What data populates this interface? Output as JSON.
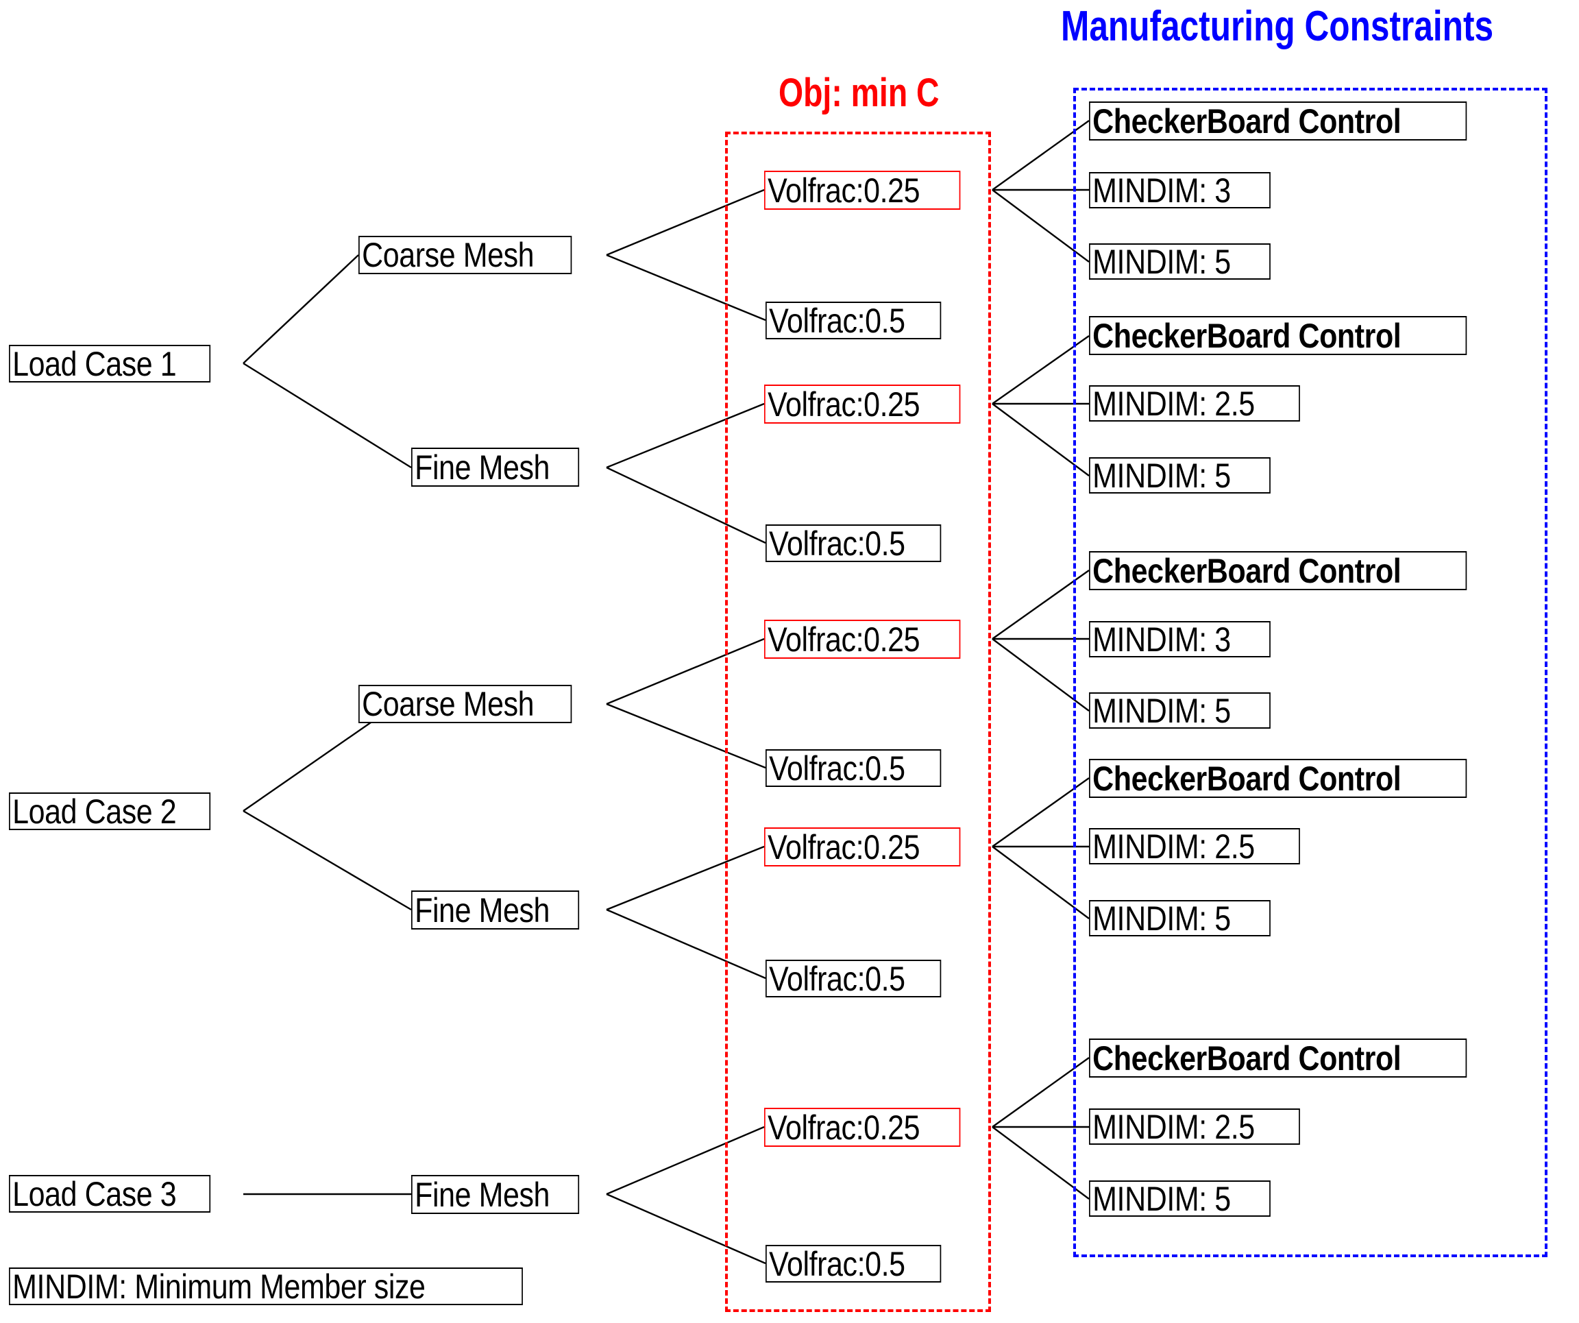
{
  "diagram": {
    "title_objective": "Obj: min C",
    "title_manufacturing": "Manufacturing Constraints",
    "legend": "MINDIM: Minimum Member size",
    "colors": {
      "objective_region": "#ff0000",
      "manufacturing_region": "#0000ff",
      "node_border": "#000000",
      "highlighted_node_border": "#ff0000"
    },
    "load_cases": [
      {
        "label": "Load Case 1",
        "meshes": [
          {
            "label": "Coarse Mesh",
            "volfracs": [
              {
                "label": "Volfrac:0.25",
                "highlighted": true,
                "constraints": [
                  "CheckerBoard Control",
                  "MINDIM: 3",
                  "MINDIM: 5"
                ]
              },
              {
                "label": "Volfrac:0.5",
                "highlighted": false,
                "constraints": []
              }
            ]
          },
          {
            "label": "Fine Mesh",
            "volfracs": [
              {
                "label": "Volfrac:0.25",
                "highlighted": true,
                "constraints": [
                  "CheckerBoard Control",
                  "MINDIM: 2.5",
                  "MINDIM: 5"
                ]
              },
              {
                "label": "Volfrac:0.5",
                "highlighted": false,
                "constraints": []
              }
            ]
          }
        ]
      },
      {
        "label": "Load Case 2",
        "meshes": [
          {
            "label": "Coarse Mesh",
            "volfracs": [
              {
                "label": "Volfrac:0.25",
                "highlighted": true,
                "constraints": [
                  "CheckerBoard Control",
                  "MINDIM: 3",
                  "MINDIM: 5"
                ]
              },
              {
                "label": "Volfrac:0.5",
                "highlighted": false,
                "constraints": []
              }
            ]
          },
          {
            "label": "Fine Mesh",
            "volfracs": [
              {
                "label": "Volfrac:0.25",
                "highlighted": true,
                "constraints": [
                  "CheckerBoard Control",
                  "MINDIM: 2.5",
                  "MINDIM: 5"
                ]
              },
              {
                "label": "Volfrac:0.5",
                "highlighted": false,
                "constraints": []
              }
            ]
          }
        ]
      },
      {
        "label": "Load Case 3",
        "meshes": [
          {
            "label": "Fine Mesh",
            "volfracs": [
              {
                "label": "Volfrac:0.25",
                "highlighted": true,
                "constraints": [
                  "CheckerBoard Control",
                  "MINDIM: 2.5",
                  "MINDIM: 5"
                ]
              },
              {
                "label": "Volfrac:0.5",
                "highlighted": false,
                "constraints": []
              }
            ]
          }
        ]
      }
    ],
    "nodes": {
      "load_case_1": "Load Case 1",
      "load_case_2": "Load Case 2",
      "load_case_3": "Load Case 3",
      "coarse_mesh_1": "Coarse Mesh",
      "fine_mesh_1": "Fine Mesh",
      "coarse_mesh_2": "Coarse Mesh",
      "fine_mesh_2": "Fine Mesh",
      "fine_mesh_3": "Fine Mesh",
      "vf_a_25": "Volfrac:0.25",
      "vf_a_50": "Volfrac:0.5",
      "vf_b_25": "Volfrac:0.25",
      "vf_b_50": "Volfrac:0.5",
      "vf_c_25": "Volfrac:0.25",
      "vf_c_50": "Volfrac:0.5",
      "vf_d_25": "Volfrac:0.25",
      "vf_d_50": "Volfrac:0.5",
      "vf_e_25": "Volfrac:0.25",
      "vf_e_50": "Volfrac:0.5",
      "cb_1": "CheckerBoard Control",
      "md_1a": "MINDIM: 3",
      "md_1b": "MINDIM: 5",
      "cb_2": "CheckerBoard Control",
      "md_2a": "MINDIM: 2.5",
      "md_2b": "MINDIM: 5",
      "cb_3": "CheckerBoard Control",
      "md_3a": "MINDIM: 3",
      "md_3b": "MINDIM: 5",
      "cb_4": "CheckerBoard Control",
      "md_4a": "MINDIM: 2.5",
      "md_4b": "MINDIM: 5",
      "cb_5": "CheckerBoard Control",
      "md_5a": "MINDIM: 2.5",
      "md_5b": "MINDIM: 5"
    }
  }
}
